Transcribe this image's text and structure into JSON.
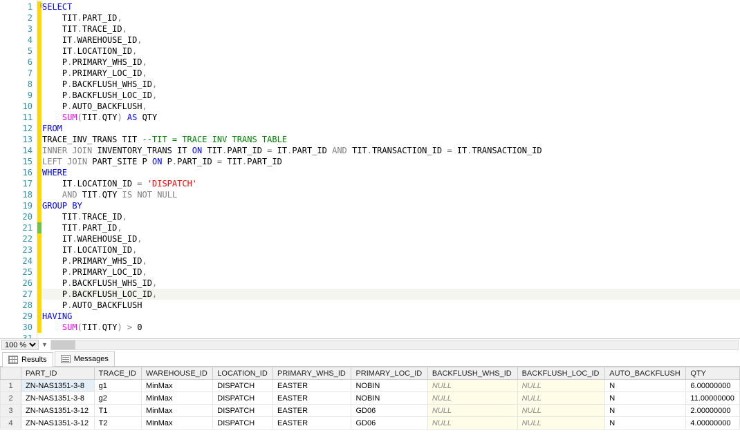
{
  "zoom": "100 %",
  "tabs": {
    "results": "Results",
    "messages": "Messages"
  },
  "code": [
    {
      "indent": 0,
      "tokens": [
        {
          "t": "SELECT",
          "c": "k"
        }
      ]
    },
    {
      "indent": 1,
      "tokens": [
        {
          "t": "TIT",
          "c": "n"
        },
        {
          "t": ".",
          "c": "op"
        },
        {
          "t": "PART_ID",
          "c": "n"
        },
        {
          "t": ",",
          "c": "op"
        }
      ]
    },
    {
      "indent": 1,
      "tokens": [
        {
          "t": "TIT",
          "c": "n"
        },
        {
          "t": ".",
          "c": "op"
        },
        {
          "t": "TRACE_ID",
          "c": "n"
        },
        {
          "t": ",",
          "c": "op"
        }
      ]
    },
    {
      "indent": 1,
      "tokens": [
        {
          "t": "IT",
          "c": "n"
        },
        {
          "t": ".",
          "c": "op"
        },
        {
          "t": "WAREHOUSE_ID",
          "c": "n"
        },
        {
          "t": ",",
          "c": "op"
        }
      ]
    },
    {
      "indent": 1,
      "tokens": [
        {
          "t": "IT",
          "c": "n"
        },
        {
          "t": ".",
          "c": "op"
        },
        {
          "t": "LOCATION_ID",
          "c": "n"
        },
        {
          "t": ",",
          "c": "op"
        }
      ]
    },
    {
      "indent": 1,
      "tokens": [
        {
          "t": "P",
          "c": "n"
        },
        {
          "t": ".",
          "c": "op"
        },
        {
          "t": "PRIMARY_WHS_ID",
          "c": "n"
        },
        {
          "t": ",",
          "c": "op"
        }
      ]
    },
    {
      "indent": 1,
      "tokens": [
        {
          "t": "P",
          "c": "n"
        },
        {
          "t": ".",
          "c": "op"
        },
        {
          "t": "PRIMARY_LOC_ID",
          "c": "n"
        },
        {
          "t": ",",
          "c": "op"
        }
      ]
    },
    {
      "indent": 1,
      "tokens": [
        {
          "t": "P",
          "c": "n"
        },
        {
          "t": ".",
          "c": "op"
        },
        {
          "t": "BACKFLUSH_WHS_ID",
          "c": "n"
        },
        {
          "t": ",",
          "c": "op"
        }
      ]
    },
    {
      "indent": 1,
      "tokens": [
        {
          "t": "P",
          "c": "n"
        },
        {
          "t": ".",
          "c": "op"
        },
        {
          "t": "BACKFLUSH_LOC_ID",
          "c": "n"
        },
        {
          "t": ",",
          "c": "op"
        }
      ]
    },
    {
      "indent": 1,
      "tokens": [
        {
          "t": "P",
          "c": "n"
        },
        {
          "t": ".",
          "c": "op"
        },
        {
          "t": "AUTO_BACKFLUSH",
          "c": "n"
        },
        {
          "t": ",",
          "c": "op"
        }
      ]
    },
    {
      "indent": 1,
      "tokens": [
        {
          "t": "SUM",
          "c": "f"
        },
        {
          "t": "(",
          "c": "op"
        },
        {
          "t": "TIT",
          "c": "n"
        },
        {
          "t": ".",
          "c": "op"
        },
        {
          "t": "QTY",
          "c": "n"
        },
        {
          "t": ")",
          "c": "op"
        },
        {
          "t": " ",
          "c": "n"
        },
        {
          "t": "AS",
          "c": "k"
        },
        {
          "t": " QTY",
          "c": "n"
        }
      ]
    },
    {
      "indent": 0,
      "tokens": [
        {
          "t": "FROM",
          "c": "k"
        }
      ]
    },
    {
      "indent": 0,
      "tokens": [
        {
          "t": "TRACE_INV_TRANS TIT ",
          "c": "n"
        },
        {
          "t": "--TIT = TRACE INV TRANS TABLE",
          "c": "g"
        }
      ]
    },
    {
      "indent": 0,
      "tokens": [
        {
          "t": "INNER",
          "c": "c"
        },
        {
          "t": " ",
          "c": "n"
        },
        {
          "t": "JOIN",
          "c": "c"
        },
        {
          "t": " INVENTORY_TRANS IT ",
          "c": "n"
        },
        {
          "t": "ON",
          "c": "k"
        },
        {
          "t": " TIT",
          "c": "n"
        },
        {
          "t": ".",
          "c": "op"
        },
        {
          "t": "PART_ID ",
          "c": "n"
        },
        {
          "t": "=",
          "c": "op"
        },
        {
          "t": " IT",
          "c": "n"
        },
        {
          "t": ".",
          "c": "op"
        },
        {
          "t": "PART_ID ",
          "c": "n"
        },
        {
          "t": "AND",
          "c": "c"
        },
        {
          "t": " TIT",
          "c": "n"
        },
        {
          "t": ".",
          "c": "op"
        },
        {
          "t": "TRANSACTION_ID ",
          "c": "n"
        },
        {
          "t": "=",
          "c": "op"
        },
        {
          "t": " IT",
          "c": "n"
        },
        {
          "t": ".",
          "c": "op"
        },
        {
          "t": "TRANSACTION_ID",
          "c": "n"
        }
      ]
    },
    {
      "indent": 0,
      "tokens": [
        {
          "t": "LEFT",
          "c": "c"
        },
        {
          "t": " ",
          "c": "n"
        },
        {
          "t": "JOIN",
          "c": "c"
        },
        {
          "t": " PART_SITE P ",
          "c": "n"
        },
        {
          "t": "ON",
          "c": "k"
        },
        {
          "t": " P",
          "c": "n"
        },
        {
          "t": ".",
          "c": "op"
        },
        {
          "t": "PART_ID ",
          "c": "n"
        },
        {
          "t": "=",
          "c": "op"
        },
        {
          "t": " TIT",
          "c": "n"
        },
        {
          "t": ".",
          "c": "op"
        },
        {
          "t": "PART_ID",
          "c": "n"
        }
      ]
    },
    {
      "indent": 0,
      "tokens": [
        {
          "t": "WHERE",
          "c": "k"
        }
      ]
    },
    {
      "indent": 1,
      "tokens": [
        {
          "t": "IT",
          "c": "n"
        },
        {
          "t": ".",
          "c": "op"
        },
        {
          "t": "LOCATION_ID ",
          "c": "n"
        },
        {
          "t": "=",
          "c": "op"
        },
        {
          "t": " ",
          "c": "n"
        },
        {
          "t": "'DISPATCH'",
          "c": "s"
        }
      ]
    },
    {
      "indent": 1,
      "tokens": [
        {
          "t": "AND",
          "c": "c"
        },
        {
          "t": " TIT",
          "c": "n"
        },
        {
          "t": ".",
          "c": "op"
        },
        {
          "t": "QTY ",
          "c": "n"
        },
        {
          "t": "IS",
          "c": "c"
        },
        {
          "t": " ",
          "c": "n"
        },
        {
          "t": "NOT",
          "c": "c"
        },
        {
          "t": " ",
          "c": "n"
        },
        {
          "t": "NULL",
          "c": "c"
        }
      ]
    },
    {
      "indent": 0,
      "tokens": [
        {
          "t": "GROUP BY",
          "c": "k"
        }
      ]
    },
    {
      "indent": 1,
      "tokens": [
        {
          "t": "TIT",
          "c": "n"
        },
        {
          "t": ".",
          "c": "op"
        },
        {
          "t": "TRACE_ID",
          "c": "n"
        },
        {
          "t": ",",
          "c": "op"
        }
      ]
    },
    {
      "indent": 1,
      "tokens": [
        {
          "t": "TIT",
          "c": "n"
        },
        {
          "t": ".",
          "c": "op"
        },
        {
          "t": "PART_ID",
          "c": "n"
        },
        {
          "t": ",",
          "c": "op"
        }
      ]
    },
    {
      "indent": 1,
      "tokens": [
        {
          "t": "IT",
          "c": "n"
        },
        {
          "t": ".",
          "c": "op"
        },
        {
          "t": "WAREHOUSE_ID",
          "c": "n"
        },
        {
          "t": ",",
          "c": "op"
        }
      ]
    },
    {
      "indent": 1,
      "tokens": [
        {
          "t": "IT",
          "c": "n"
        },
        {
          "t": ".",
          "c": "op"
        },
        {
          "t": "LOCATION_ID",
          "c": "n"
        },
        {
          "t": ",",
          "c": "op"
        }
      ]
    },
    {
      "indent": 1,
      "tokens": [
        {
          "t": "P",
          "c": "n"
        },
        {
          "t": ".",
          "c": "op"
        },
        {
          "t": "PRIMARY_WHS_ID",
          "c": "n"
        },
        {
          "t": ",",
          "c": "op"
        }
      ]
    },
    {
      "indent": 1,
      "tokens": [
        {
          "t": "P",
          "c": "n"
        },
        {
          "t": ".",
          "c": "op"
        },
        {
          "t": "PRIMARY_LOC_ID",
          "c": "n"
        },
        {
          "t": ",",
          "c": "op"
        }
      ]
    },
    {
      "indent": 1,
      "tokens": [
        {
          "t": "P",
          "c": "n"
        },
        {
          "t": ".",
          "c": "op"
        },
        {
          "t": "BACKFLUSH_WHS_ID",
          "c": "n"
        },
        {
          "t": ",",
          "c": "op"
        }
      ]
    },
    {
      "indent": 1,
      "hl": true,
      "tokens": [
        {
          "t": "P",
          "c": "n"
        },
        {
          "t": ".",
          "c": "op"
        },
        {
          "t": "BACKFLUSH_LOC_ID",
          "c": "n"
        },
        {
          "t": ",",
          "c": "op"
        }
      ]
    },
    {
      "indent": 1,
      "tokens": [
        {
          "t": "P",
          "c": "n"
        },
        {
          "t": ".",
          "c": "op"
        },
        {
          "t": "AUTO_BACKFLUSH",
          "c": "n"
        }
      ]
    },
    {
      "indent": 0,
      "tokens": [
        {
          "t": "HAVING",
          "c": "k"
        }
      ]
    },
    {
      "indent": 1,
      "tokens": [
        {
          "t": "SUM",
          "c": "f"
        },
        {
          "t": "(",
          "c": "op"
        },
        {
          "t": "TIT",
          "c": "n"
        },
        {
          "t": ".",
          "c": "op"
        },
        {
          "t": "QTY",
          "c": "n"
        },
        {
          "t": ")",
          "c": "op"
        },
        {
          "t": " ",
          "c": "n"
        },
        {
          "t": ">",
          "c": "op"
        },
        {
          "t": " 0",
          "c": "n"
        }
      ]
    },
    {
      "indent": 0,
      "tokens": []
    }
  ],
  "marks": [
    "y",
    "y",
    "y",
    "y",
    "y",
    "y",
    "y",
    "y",
    "y",
    "y",
    "y",
    "y",
    "y",
    "y",
    "y",
    "y",
    "y",
    "y",
    "y",
    "y",
    "g",
    "y",
    "y",
    "y",
    "y",
    "y",
    "y",
    "y",
    "y",
    "y",
    ""
  ],
  "columns": [
    "PART_ID",
    "TRACE_ID",
    "WAREHOUSE_ID",
    "LOCATION_ID",
    "PRIMARY_WHS_ID",
    "PRIMARY_LOC_ID",
    "BACKFLUSH_WHS_ID",
    "BACKFLUSH_LOC_ID",
    "AUTO_BACKFLUSH",
    "QTY"
  ],
  "rows": [
    [
      "ZN-NAS1351-3-8",
      "g1",
      "MinMax",
      "DISPATCH",
      "EASTER",
      "NOBIN",
      null,
      null,
      "N",
      "6.00000000"
    ],
    [
      "ZN-NAS1351-3-8",
      "g2",
      "MinMax",
      "DISPATCH",
      "EASTER",
      "NOBIN",
      null,
      null,
      "N",
      "11.00000000"
    ],
    [
      "ZN-NAS1351-3-12",
      "T1",
      "MinMax",
      "DISPATCH",
      "EASTER",
      "GD06",
      null,
      null,
      "N",
      "2.00000000"
    ],
    [
      "ZN-NAS1351-3-12",
      "T2",
      "MinMax",
      "DISPATCH",
      "EASTER",
      "GD06",
      null,
      null,
      "N",
      "4.00000000"
    ]
  ],
  "null_text": "NULL"
}
